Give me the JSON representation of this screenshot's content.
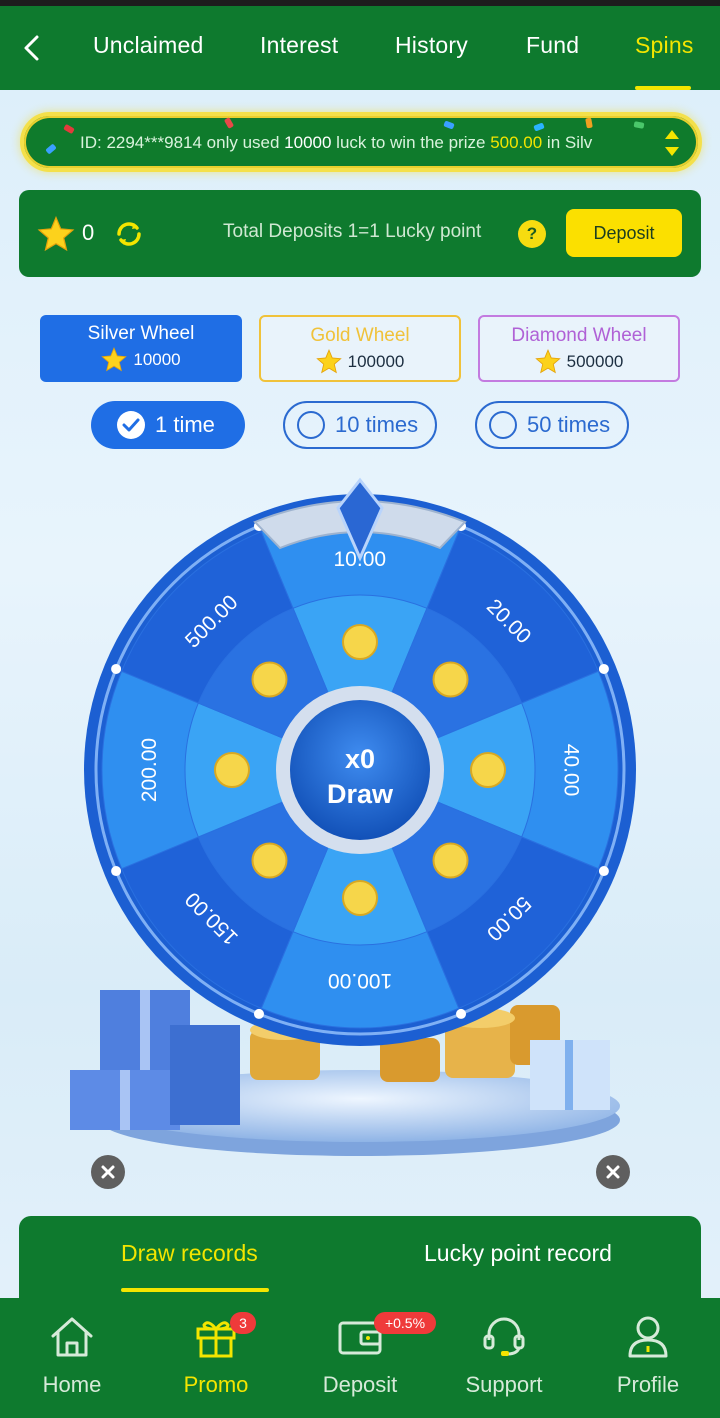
{
  "header": {
    "tabs": [
      {
        "label": "Unclaimed"
      },
      {
        "label": "Interest"
      },
      {
        "label": "History"
      },
      {
        "label": "Fund"
      },
      {
        "label": "Spins"
      }
    ],
    "active_tab": "Spins"
  },
  "marquee": {
    "prefix": "ID: 2294***9814 only used ",
    "luck": "10000",
    "middle": " luck to win the prize ",
    "prize": "500.00",
    "suffix": " in Silv"
  },
  "lucky": {
    "points": "0",
    "info": "Total Deposits 1=1 Lucky point",
    "help": "?",
    "deposit_label": "Deposit"
  },
  "wheels": [
    {
      "name": "Silver Wheel",
      "cost": "10000"
    },
    {
      "name": "Gold Wheel",
      "cost": "100000"
    },
    {
      "name": "Diamond Wheel",
      "cost": "500000"
    }
  ],
  "times": [
    {
      "label": "1 time"
    },
    {
      "label": "10 times"
    },
    {
      "label": "50 times"
    }
  ],
  "wheel": {
    "prizes": [
      "10.00",
      "20.00",
      "40.00",
      "50.00",
      "100.00",
      "150.00",
      "200.00",
      "500.00"
    ],
    "multiplier": "x0",
    "draw_label": "Draw"
  },
  "records": {
    "tabs": [
      {
        "label": "Draw records"
      },
      {
        "label": "Lucky point record"
      }
    ]
  },
  "bottom_nav": [
    {
      "label": "Home",
      "icon": "home-icon"
    },
    {
      "label": "Promo",
      "icon": "gift-icon",
      "badge": "3"
    },
    {
      "label": "Deposit",
      "icon": "wallet-icon",
      "badge": "+0.5%"
    },
    {
      "label": "Support",
      "icon": "headset-icon"
    },
    {
      "label": "Profile",
      "icon": "profile-icon"
    }
  ],
  "colors": {
    "brand_green": "#0e7a2e",
    "accent_yellow": "#f3e500",
    "wheel_blue": "#1f6ee5"
  }
}
